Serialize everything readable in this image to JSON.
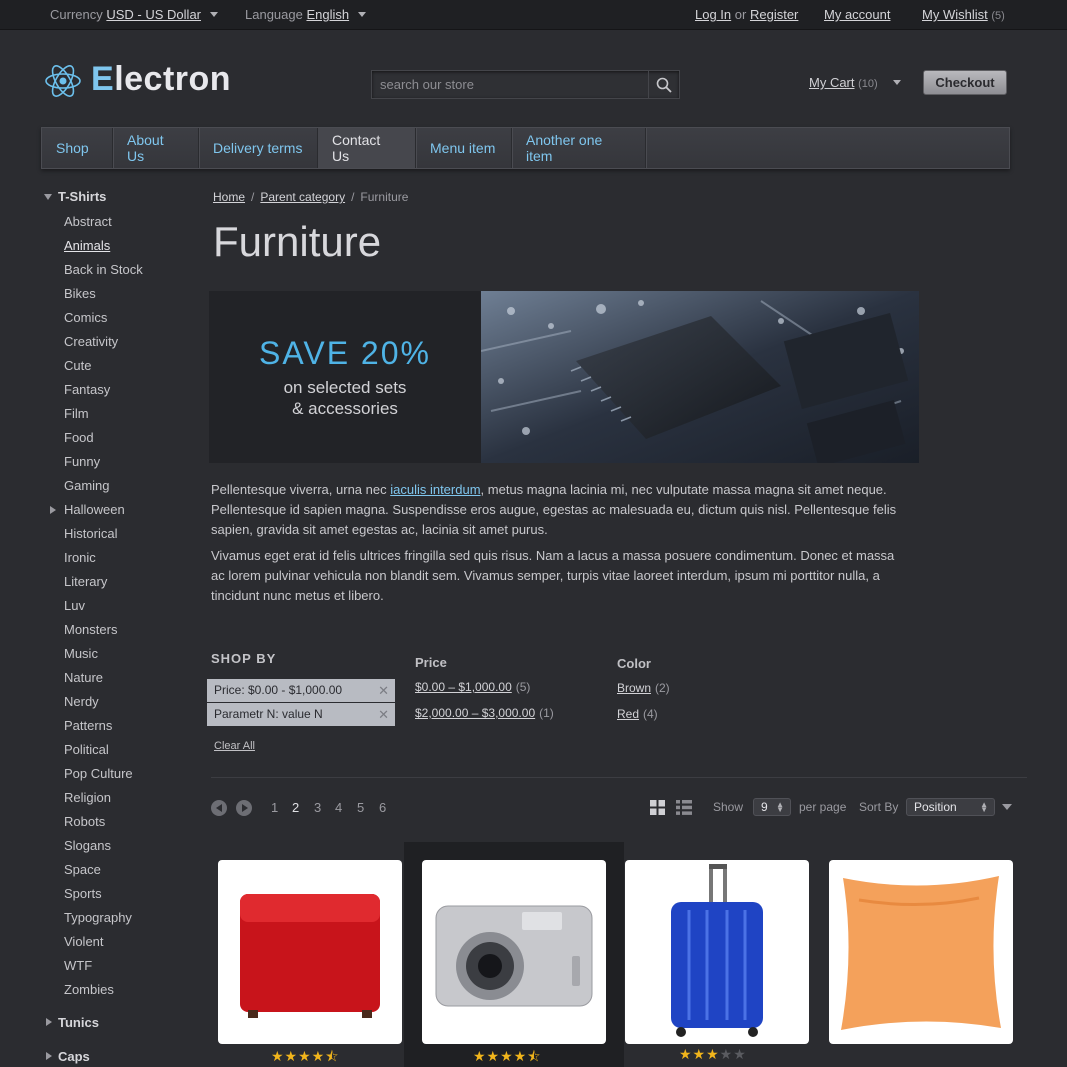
{
  "topbar": {
    "currency_label": "Currency",
    "currency_value": "USD - US Dollar",
    "language_label": "Language",
    "language_value": "English",
    "login": "Log In",
    "or": "or",
    "register": "Register",
    "account": "My account",
    "wishlist": "My Wishlist",
    "wishlist_count": "(5)"
  },
  "header": {
    "logo_first": "E",
    "logo_rest": "lectron",
    "search_placeholder": "search our store",
    "cart_label": "My Cart",
    "cart_count": "(10)",
    "checkout": "Checkout"
  },
  "nav": [
    "Shop",
    "About Us",
    "Delivery terms",
    "Contact Us",
    "Menu item",
    "Another one item"
  ],
  "sidebar": {
    "heading": "T-Shirts",
    "items": [
      "Abstract",
      "Animals",
      "Back in Stock",
      "Bikes",
      "Comics",
      "Creativity",
      "Cute",
      "Fantasy",
      "Film",
      "Food",
      "Funny",
      "Gaming",
      "Halloween",
      "Historical",
      "Ironic",
      "Literary",
      "Luv",
      "Monsters",
      "Music",
      "Nature",
      "Nerdy",
      "Patterns",
      "Political",
      "Pop Culture",
      "Religion",
      "Robots",
      "Slogans",
      "Space",
      "Sports",
      "Typography",
      "Violent",
      "WTF",
      "Zombies"
    ],
    "footer1": "Tunics",
    "footer2": "Caps"
  },
  "breadcrumb": {
    "home": "Home",
    "parent": "Parent category",
    "current": "Furniture",
    "sep": "/"
  },
  "page_title": "Furniture",
  "banner": {
    "headline": "SAVE 20%",
    "line1": "on selected sets",
    "line2": "& accessories"
  },
  "body": {
    "p1_a": "Pellentesque viverra, urna nec ",
    "p1_link": "iaculis interdum",
    "p1_b": ", metus magna lacinia mi, nec vulputate massa magna sit amet neque. Pellentesque id sapien magna. Suspendisse eros augue, egestas ac malesuada eu, dictum quis nisl. Pellentesque felis sapien, gravida sit amet egestas ac, lacinia sit amet purus.",
    "p2": "Vivamus eget erat id felis ultrices fringilla sed quis risus. Nam a lacus a massa posuere condimentum. Donec et massa ac lorem pulvinar vehicula non blandit sem. Vivamus semper, turpis vitae laoreet interdum, ipsum mi porttitor nulla, a tincidunt nunc metus et libero."
  },
  "shopby": {
    "title": "SHOP BY",
    "chip1": "Price: $0.00 - $1,000.00",
    "chip2": "Parametr N: value N",
    "clear": "Clear All",
    "price_head": "Price",
    "price1": "$0.00 – $1,000.00",
    "price1_count": "(5)",
    "price2": "$2,000.00 – $3,000.00",
    "price2_count": "(1)",
    "color_head": "Color",
    "color1": "Brown",
    "color1_count": "(2)",
    "color2": "Red",
    "color2_count": "(4)"
  },
  "toolbar": {
    "pages": [
      "1",
      "2",
      "3",
      "4",
      "5",
      "6"
    ],
    "show": "Show",
    "show_value": "9",
    "per_page": "per page",
    "sort_by": "Sort By",
    "sort_value": "Position"
  },
  "products": [
    {
      "name": "red-ottoman",
      "rating": 4.5
    },
    {
      "name": "digital-camera",
      "rating": 4.5
    },
    {
      "name": "blue-suitcase",
      "rating": 3
    },
    {
      "name": "orange-pillow",
      "rating": 0
    }
  ],
  "colors": {
    "accent": "#7fc6ee",
    "star": "#f1b51c",
    "background": "#2b2c30"
  }
}
